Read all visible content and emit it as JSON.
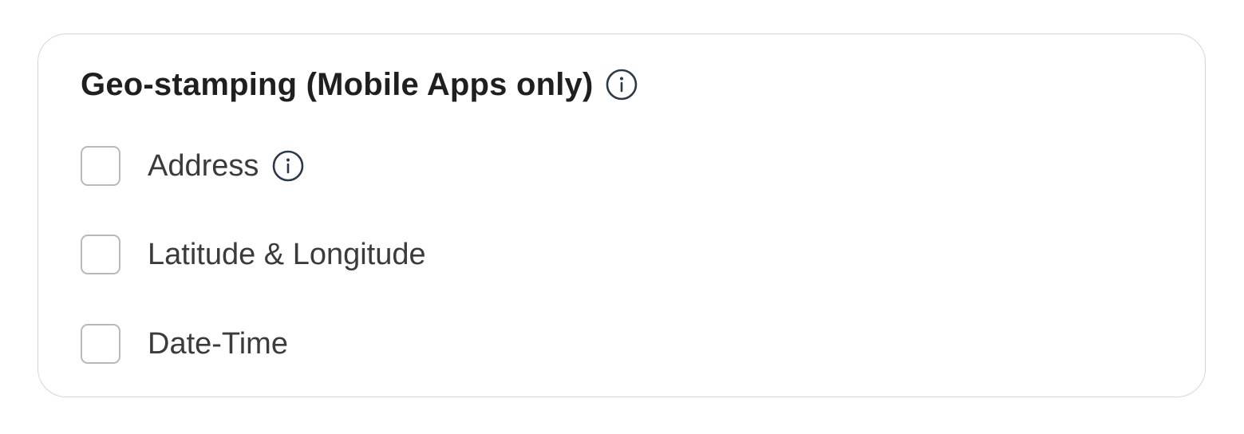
{
  "section": {
    "title": "Geo-stamping (Mobile Apps only)",
    "title_icon": "info-icon"
  },
  "options": [
    {
      "label": "Address",
      "checked": false,
      "icon": "info-icon"
    },
    {
      "label": "Latitude & Longitude",
      "checked": false
    },
    {
      "label": "Date-Time",
      "checked": false
    }
  ],
  "colors": {
    "title_text": "#1f1f1f",
    "label_text": "#3b3b3b",
    "checkbox_border": "#b9b9b9",
    "card_border": "#d6d6d6",
    "icon_stroke": "#2b3a4a"
  }
}
